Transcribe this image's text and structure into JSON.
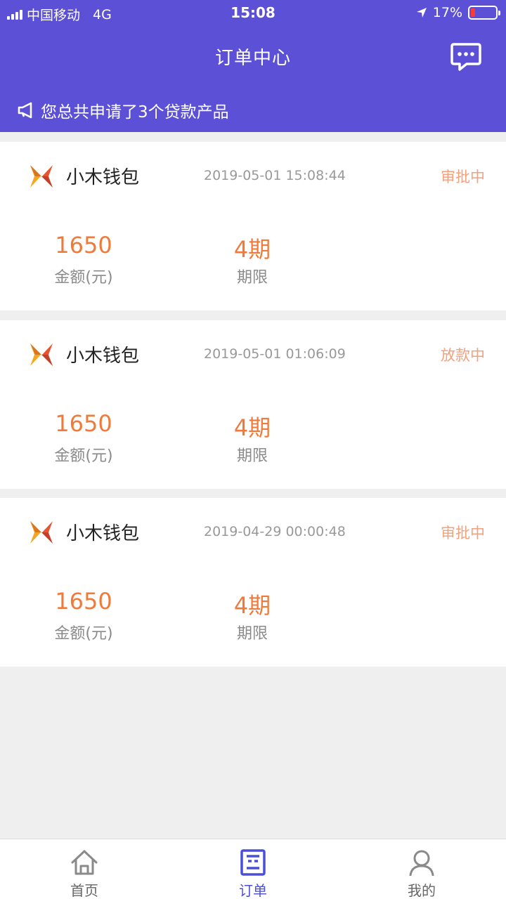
{
  "status_bar": {
    "carrier": "中国移动",
    "network": "4G",
    "time": "15:08",
    "battery": "17%",
    "battery_level": 0.17
  },
  "header": {
    "title": "订单中心",
    "notice": "您总共申请了3个贷款产品"
  },
  "orders": [
    {
      "product": "小木钱包",
      "time": "2019-05-01 15:08:44",
      "status": "审批中",
      "amount": "1650",
      "amount_label": "金额(元)",
      "term": "4期",
      "term_label": "期限"
    },
    {
      "product": "小木钱包",
      "time": "2019-05-01 01:06:09",
      "status": "放款中",
      "amount": "1650",
      "amount_label": "金额(元)",
      "term": "4期",
      "term_label": "期限"
    },
    {
      "product": "小木钱包",
      "time": "2019-04-29 00:00:48",
      "status": "审批中",
      "amount": "1650",
      "amount_label": "金额(元)",
      "term": "4期",
      "term_label": "期限"
    }
  ],
  "tabs": [
    {
      "label": "首页",
      "icon": "home-icon"
    },
    {
      "label": "订单",
      "icon": "order-icon",
      "active": true
    },
    {
      "label": "我的",
      "icon": "profile-icon"
    }
  ],
  "colors": {
    "header_bg": "#5b50d6",
    "accent_orange": "#f07a3a",
    "status_orange": "#f4a07a",
    "tab_active": "#4a4fd6"
  }
}
